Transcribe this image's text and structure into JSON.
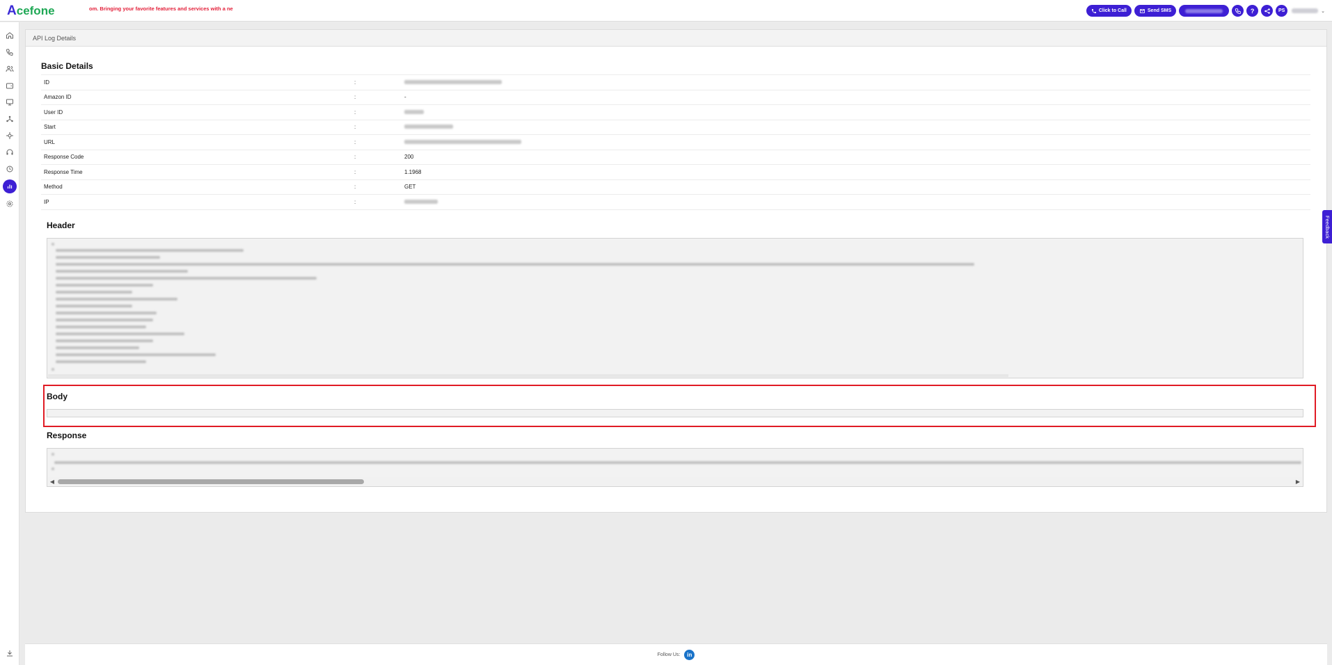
{
  "brand": {
    "logo_mark": "A",
    "logo_rest": "cefone"
  },
  "ticker": "om. Bringing your favorite features and services with a ne",
  "topbar": {
    "click_to_call": "Click to Call",
    "send_sms": "Send SMS",
    "help": "?",
    "avatar_initials": "PS"
  },
  "breadcrumb": "API Log Details",
  "basic_details": {
    "title": "Basic Details",
    "rows": [
      {
        "label": "ID",
        "sep": ":",
        "value": ""
      },
      {
        "label": "Amazon ID",
        "sep": ":",
        "value": "-"
      },
      {
        "label": "User ID",
        "sep": ":",
        "value": ""
      },
      {
        "label": "Start",
        "sep": ":",
        "value": ""
      },
      {
        "label": "URL",
        "sep": ":",
        "value": ""
      },
      {
        "label": "Response Code",
        "sep": ":",
        "value": "200"
      },
      {
        "label": "Response Time",
        "sep": ":",
        "value": "1.1968"
      },
      {
        "label": "Method",
        "sep": ":",
        "value": "GET"
      },
      {
        "label": "IP",
        "sep": ":",
        "value": ""
      }
    ]
  },
  "sections": {
    "header_title": "Header",
    "body_title": "Body",
    "response_title": "Response"
  },
  "feedback": "Feedback",
  "footer": {
    "follow_us": "Follow Us:",
    "linkedin": "in"
  },
  "colors": {
    "accent": "#3d1fd4",
    "highlight": "#e01b24",
    "brand_green": "#1fa855",
    "ticker_red": "#e3203a"
  },
  "icons": {
    "sidebar": [
      "home-icon",
      "phone-icon",
      "users-icon",
      "wallet-icon",
      "monitor-icon",
      "network-icon",
      "flow-icon",
      "headset-icon",
      "clock-icon",
      "bar-chart-icon",
      "settings-icon",
      "download-icon"
    ]
  }
}
